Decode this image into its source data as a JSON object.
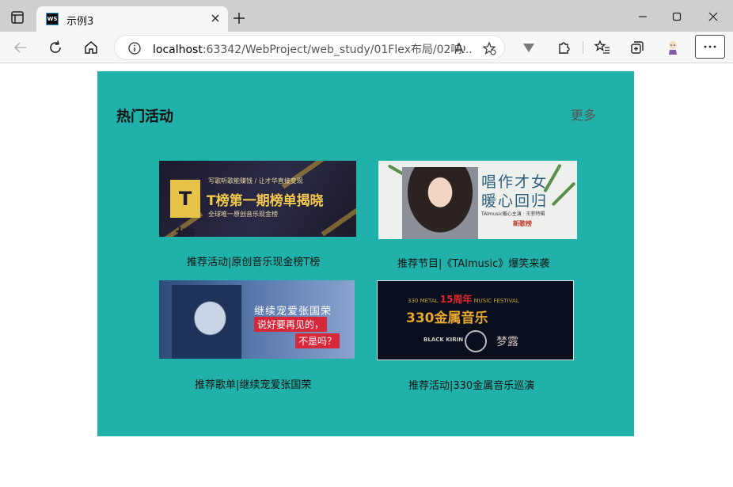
{
  "browser": {
    "tab_title": "示例3",
    "favicon_text": "WS",
    "url_host": "localhost",
    "url_rest": ":63342/WebProject/web_study/01Flex布局/02响..."
  },
  "page": {
    "section_title": "热门活动",
    "more_label": "更多",
    "cards": [
      {
        "caption": "推荐活动|原创音乐现金榜T榜",
        "banner": {
          "logo": "T榜",
          "line1": "写歌听歌能赚钱 / 让才华直接变现",
          "line2": "T榜第一期榜单揭晓",
          "line3": "全球唯一原创音乐现金榜"
        }
      },
      {
        "caption": "推荐节目|《TAlmusic》爆笑来袭",
        "banner": {
          "line1": "唱作才女",
          "line2": "暖心回归",
          "line3": "TAlmusic暖心主演 · 王菲特辑",
          "line4": "新歌榜"
        }
      },
      {
        "caption": "推荐歌单|继续宠爱张国荣",
        "banner": {
          "line1": "继续宠爱张国荣",
          "line2": "说好要再见的，",
          "line3": "不是吗？"
        }
      },
      {
        "caption": "推荐活动|330金属音乐巡演",
        "banner": {
          "line1a": "330 METAL ",
          "line1b": "15周年",
          "line1c": " MUSIC FESTIVAL",
          "line2": "330金属音乐",
          "line3": "BLACK KIRIN",
          "line4": "梦露"
        }
      }
    ]
  },
  "colors": {
    "panel": "#20b2aa",
    "accent_gold": "#f2c94c"
  }
}
